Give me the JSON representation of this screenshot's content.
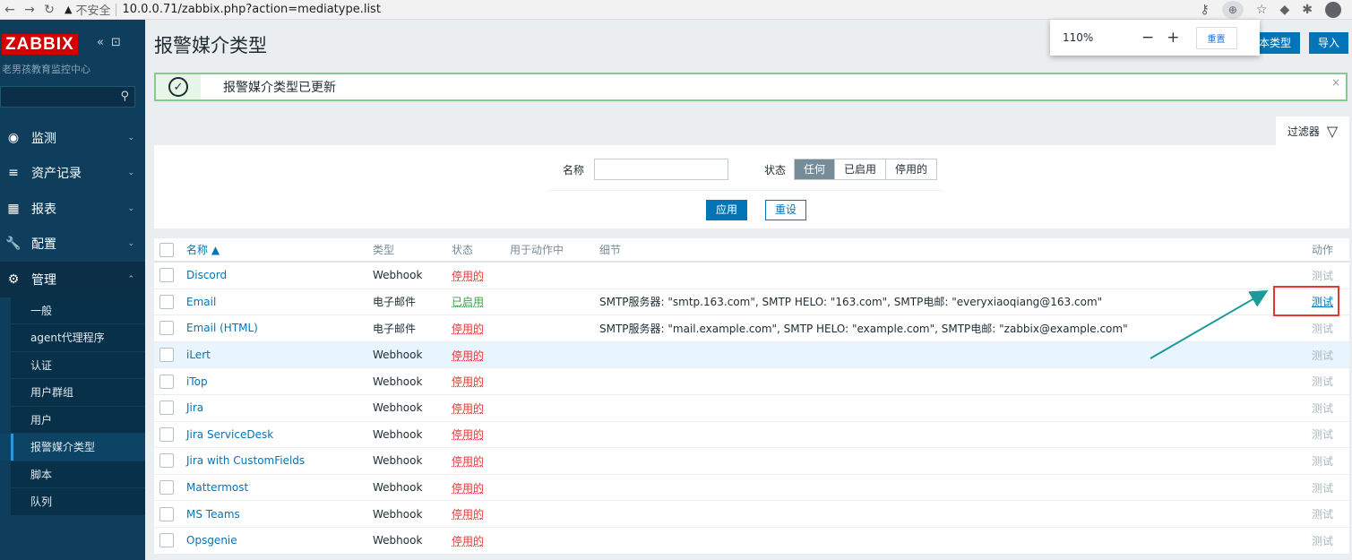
{
  "browser": {
    "security_label": "不安全",
    "url": "10.0.0.71/zabbix.php?action=mediatype.list"
  },
  "zoom_popup": {
    "percent": "110%",
    "minus": "−",
    "plus": "+",
    "reset": "重置"
  },
  "sidebar": {
    "logo": "ZABBIX",
    "org": "老男孩教育监控中心",
    "menu": [
      {
        "label": "监测"
      },
      {
        "label": "资产记录"
      },
      {
        "label": "报表"
      },
      {
        "label": "配置"
      },
      {
        "label": "管理"
      }
    ],
    "submenu": [
      {
        "label": "一般"
      },
      {
        "label": "agent代理程序"
      },
      {
        "label": "认证"
      },
      {
        "label": "用户群组"
      },
      {
        "label": "用户"
      },
      {
        "label": "报警媒介类型"
      },
      {
        "label": "脚本"
      },
      {
        "label": "队列"
      }
    ]
  },
  "page": {
    "title": "报警媒介类型",
    "create_btn": "本类型",
    "import_btn": "导入",
    "message": "报警媒介类型已更新",
    "filter_tab": "过滤器"
  },
  "filter": {
    "name_label": "名称",
    "status_label": "状态",
    "status_options": [
      "任何",
      "已启用",
      "停用的"
    ],
    "apply": "应用",
    "reset": "重设"
  },
  "table": {
    "headers": {
      "name": "名称 ▲",
      "type": "类型",
      "status": "状态",
      "used": "用于动作中",
      "details": "细节",
      "action": "动作"
    },
    "rows": [
      {
        "name": "Discord",
        "type": "Webhook",
        "status": "停用的",
        "details": "",
        "action": "测试"
      },
      {
        "name": "Email",
        "type": "电子邮件",
        "status": "已启用",
        "details": "SMTP服务器: \"smtp.163.com\", SMTP HELO: \"163.com\", SMTP电邮: \"everyxiaoqiang@163.com\"",
        "action": "测试"
      },
      {
        "name": "Email (HTML)",
        "type": "电子邮件",
        "status": "停用的",
        "details": "SMTP服务器: \"mail.example.com\", SMTP HELO: \"example.com\", SMTP电邮: \"zabbix@example.com\"",
        "action": "测试"
      },
      {
        "name": "iLert",
        "type": "Webhook",
        "status": "停用的",
        "details": "",
        "action": "测试"
      },
      {
        "name": "iTop",
        "type": "Webhook",
        "status": "停用的",
        "details": "",
        "action": "测试"
      },
      {
        "name": "Jira",
        "type": "Webhook",
        "status": "停用的",
        "details": "",
        "action": "测试"
      },
      {
        "name": "Jira ServiceDesk",
        "type": "Webhook",
        "status": "停用的",
        "details": "",
        "action": "测试"
      },
      {
        "name": "Jira with CustomFields",
        "type": "Webhook",
        "status": "停用的",
        "details": "",
        "action": "测试"
      },
      {
        "name": "Mattermost",
        "type": "Webhook",
        "status": "停用的",
        "details": "",
        "action": "测试"
      },
      {
        "name": "MS Teams",
        "type": "Webhook",
        "status": "停用的",
        "details": "",
        "action": "测试"
      },
      {
        "name": "Opsgenie",
        "type": "Webhook",
        "status": "停用的",
        "details": "",
        "action": "测试"
      }
    ]
  },
  "colors": {
    "accent": "#0275b8",
    "sidebar": "#0e3e5c",
    "enabled": "#429e47",
    "disabled": "#e33734",
    "annotation": "#1a9a9a"
  }
}
